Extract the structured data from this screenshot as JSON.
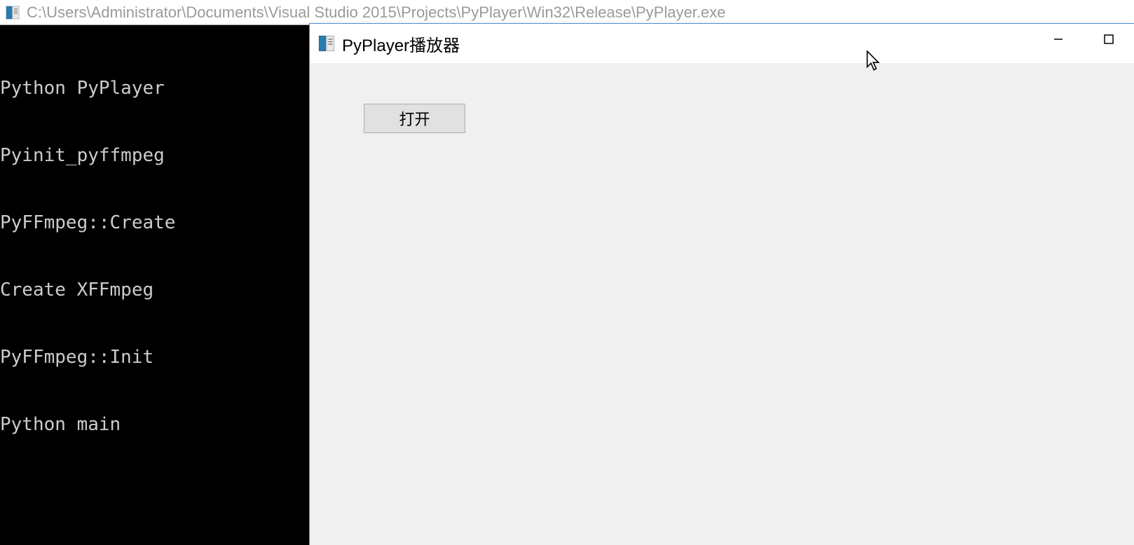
{
  "console": {
    "title": "C:\\Users\\Administrator\\Documents\\Visual Studio 2015\\Projects\\PyPlayer\\Win32\\Release\\PyPlayer.exe",
    "lines": [
      "Python PyPlayer",
      "Pyinit_pyffmpeg",
      "PyFFmpeg::Create",
      "Create XFFmpeg",
      "PyFFmpeg::Init",
      "Python main"
    ]
  },
  "player": {
    "title": "PyPlayer播放器",
    "open_label": "打开"
  }
}
